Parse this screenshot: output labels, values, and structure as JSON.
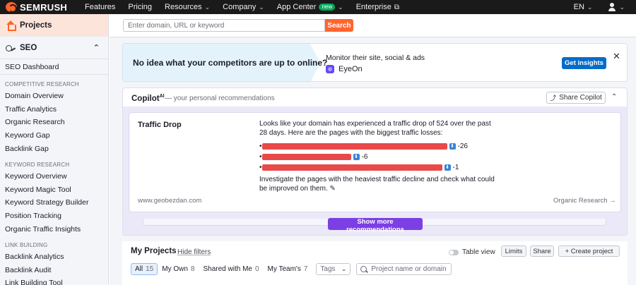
{
  "nav": {
    "brand": "SEMRUSH",
    "items": [
      {
        "label": "Features",
        "dropdown": false
      },
      {
        "label": "Pricing",
        "dropdown": false
      },
      {
        "label": "Resources",
        "dropdown": true
      },
      {
        "label": "Company",
        "dropdown": true
      },
      {
        "label": "App Center",
        "dropdown": true,
        "badge": "new"
      },
      {
        "label": "Enterprise",
        "dropdown": false,
        "external": true
      }
    ],
    "language": "EN"
  },
  "sidebar": {
    "projects_label": "Projects",
    "seo_label": "SEO",
    "dashboard_label": "SEO Dashboard",
    "groups": [
      {
        "title": "COMPETITIVE RESEARCH",
        "items": [
          "Domain Overview",
          "Traffic Analytics",
          "Organic Research",
          "Keyword Gap",
          "Backlink Gap"
        ]
      },
      {
        "title": "KEYWORD RESEARCH",
        "items": [
          "Keyword Overview",
          "Keyword Magic Tool",
          "Keyword Strategy Builder",
          "Position Tracking",
          "Organic Traffic Insights"
        ]
      },
      {
        "title": "LINK BUILDING",
        "items": [
          "Backlink Analytics",
          "Backlink Audit",
          "Link Building Tool"
        ]
      }
    ]
  },
  "search": {
    "placeholder": "Enter domain, URL or keyword",
    "button": "Search"
  },
  "banner": {
    "title": "No idea what your competitors are up to online?",
    "subtitle": "Monitor their site, social & ads",
    "product": "EyeOn",
    "cta": "Get insights",
    "close": "✕"
  },
  "copilot": {
    "title": "Copilot",
    "ai_tag": "AI",
    "subtitle": "— your personal recommendations",
    "share": "Share Copilot",
    "card": {
      "title": "Traffic Drop",
      "text": "Looks like your domain has experienced a traffic drop of 524 over the past 28 days. Here are the pages with the biggest traffic losses:",
      "pages": [
        {
          "change": "-26",
          "redacted": true
        },
        {
          "change": "-6",
          "redacted": true
        },
        {
          "change": "-1",
          "redacted": true
        }
      ],
      "advice": "Investigate the pages with the heaviest traffic decline and check what could be improved on them.",
      "domain": "www.geobezdan.com",
      "link": "Organic Research →"
    },
    "show_more": "Show more recommendations"
  },
  "projects": {
    "title": "My Projects",
    "hide_filters": "Hide filters",
    "table_view": "Table view",
    "limits": "Limits",
    "share": "Share",
    "create": "+ Create project",
    "tabs": [
      {
        "label": "All",
        "count": "15",
        "active": true
      },
      {
        "label": "My Own",
        "count": "8",
        "active": false
      },
      {
        "label": "Shared with Me",
        "count": "0",
        "active": false
      },
      {
        "label": "My Team's",
        "count": "7",
        "active": false
      }
    ],
    "tags_placeholder": "Tags",
    "search_placeholder": "Project name or domain"
  },
  "colors": {
    "brand": "#ff642d",
    "primary": "#006dca",
    "purple": "#7b3fe4",
    "redaction": "#e84a4a"
  }
}
